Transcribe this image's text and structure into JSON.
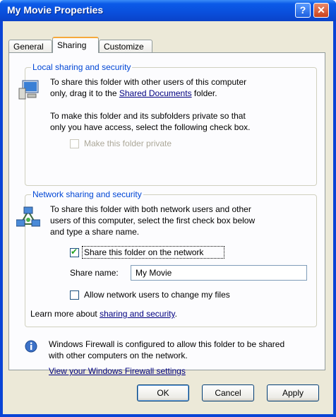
{
  "window": {
    "title": "My Movie Properties",
    "help_glyph": "?",
    "close_glyph": "✕"
  },
  "tabs": [
    {
      "label": "General"
    },
    {
      "label": "Sharing"
    },
    {
      "label": "Customize"
    }
  ],
  "local": {
    "legend": "Local sharing and security",
    "text1_line1": "To share this folder with other users of this computer",
    "text1_line2_pre": "only, drag it to the ",
    "text1_link": "Shared Documents",
    "text1_line2_post": " folder.",
    "text2_line1": "To make this folder and its subfolders private so that",
    "text2_line2": "only you have access, select the following check box.",
    "private_checkbox": "Make this folder private"
  },
  "network": {
    "legend": "Network sharing and security",
    "line1": "To share this folder with both network users and other",
    "line2": "users of this computer, select the first check box below",
    "line3": "and type a share name.",
    "share_checkbox": "Share this folder on the network",
    "share_name_label": "Share name:",
    "share_name_value": "My Movie",
    "allow_checkbox": "Allow network users to change my files",
    "learn_pre": "Learn more about ",
    "learn_link": "sharing and security",
    "learn_post": "."
  },
  "firewall": {
    "line1": "Windows Firewall is configured to allow this folder to be shared",
    "line2": "with other computers on the network.",
    "link": "View your Windows Firewall settings"
  },
  "buttons": {
    "ok": "OK",
    "cancel": "Cancel",
    "apply": "Apply"
  }
}
